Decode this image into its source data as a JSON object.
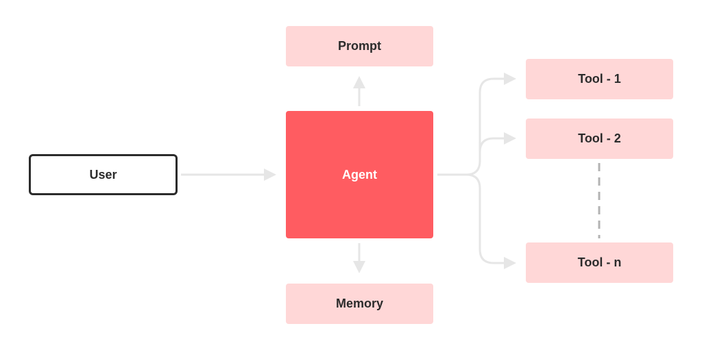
{
  "diagram": {
    "nodes": {
      "user": "User",
      "agent": "Agent",
      "prompt": "Prompt",
      "memory": "Memory",
      "tool1": "Tool - 1",
      "tool2": "Tool - 2",
      "tooln": "Tool - n"
    },
    "edges": [
      {
        "from": "User",
        "to": "Agent"
      },
      {
        "from": "Agent",
        "to": "Prompt"
      },
      {
        "from": "Agent",
        "to": "Memory"
      },
      {
        "from": "Agent",
        "to": "Tool - 1"
      },
      {
        "from": "Agent",
        "to": "Tool - 2"
      },
      {
        "from": "Agent",
        "to": "Tool - n"
      },
      {
        "from": "Tool - 2",
        "to": "Tool - n",
        "style": "dashed"
      }
    ],
    "colors": {
      "agent": "#ff5c61",
      "light_node": "#ffd7d7",
      "arrow": "#e6e6e6",
      "dashed": "#b3b3b3",
      "text": "#2b2b2b"
    }
  }
}
